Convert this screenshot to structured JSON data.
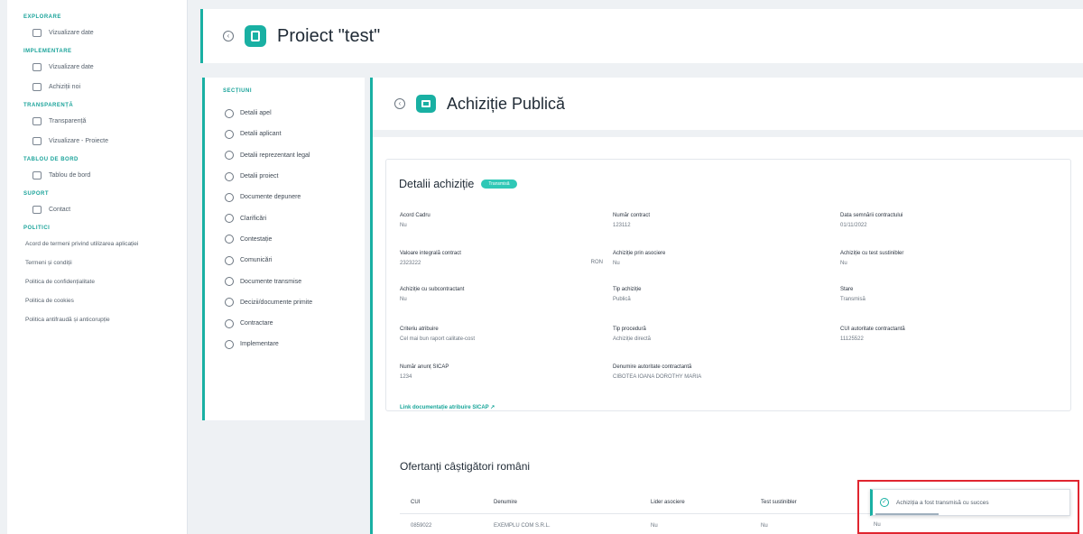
{
  "sidebar": {
    "sections": [
      {
        "title": "EXPLORARE",
        "items": [
          {
            "label": "Vizualizare date"
          }
        ]
      },
      {
        "title": "IMPLEMENTARE",
        "items": [
          {
            "label": "Vizualizare date"
          },
          {
            "label": "Achiziții noi"
          }
        ]
      },
      {
        "title": "TRANSPARENȚĂ",
        "items": [
          {
            "label": "Transparență"
          },
          {
            "label": "Vizualizare - Proiecte"
          }
        ]
      },
      {
        "title": "TABLOU DE BORD",
        "items": [
          {
            "label": "Tablou de bord"
          }
        ]
      },
      {
        "title": "SUPORT",
        "items": [
          {
            "label": "Contact"
          }
        ]
      }
    ],
    "politici_title": "POLITICI",
    "links": [
      "Acord de termeni privind utilizarea aplicației",
      "Termeni și condiții",
      "Politica de confidențialitate",
      "Politica de cookies",
      "Politica antifraudă și anticorupție"
    ]
  },
  "project": {
    "title": "Proiect \"test\""
  },
  "sections": {
    "title": "SECȚIUNI",
    "items": [
      "Detalii apel",
      "Detalii aplicant",
      "Detalii reprezentant legal",
      "Detalii proiect",
      "Documente depunere",
      "Clarificări",
      "Contestație",
      "Comunicări",
      "Documente transmise",
      "Decizii/documente primite",
      "Contractare",
      "Implementare"
    ]
  },
  "main": {
    "title": "Achiziție Publică",
    "card_title": "Detalii achiziție",
    "status_pill": "Transmisă",
    "fields": [
      {
        "label": "Acord Cadru",
        "value": "Nu"
      },
      {
        "label": "Număr contract",
        "value": "123112"
      },
      {
        "label": "Data semnării contractului",
        "value": "01/11/2022"
      },
      {
        "label": "Valoare integrală contract",
        "value": "2323222",
        "currency": "RON"
      },
      {
        "label": "Achiziție prin asociere",
        "value": "Nu"
      },
      {
        "label": "Achiziție cu test sustinibler",
        "value": "Nu"
      },
      {
        "label": "Achiziție cu subcontractant",
        "value": "Nu"
      },
      {
        "label": "Tip achiziție",
        "value": "Publică"
      },
      {
        "label": "Stare",
        "value": "Transmisă"
      },
      {
        "label": "Criteriu atribuire",
        "value": "Cel mai bun raport calitate-cost"
      },
      {
        "label": "Tip procedură",
        "value": "Achiziție directă"
      },
      {
        "label": "CUI autoritate contractantă",
        "value": "11125522"
      },
      {
        "label": "Număr anunț SICAP",
        "value": "1234"
      },
      {
        "label": "Denumire autoritate contractantă",
        "value": "CIBOTEA IOANA DOROTHY MARIA"
      }
    ],
    "sicap_link": "Link documentație atribuire SICAP",
    "winners_title": "Ofertanți câștigători români",
    "table": {
      "headers": [
        "CUI",
        "Denumire",
        "Lider asociere",
        "Test sustinibler",
        ""
      ],
      "rows": [
        [
          "0859022",
          "EXEMPLU COM S.R.L.",
          "Nu",
          "Nu",
          "Nu"
        ]
      ]
    }
  },
  "toast": {
    "message": "Achiziția a fost transmisă cu succes"
  },
  "colors": {
    "accent": "#19b0a3",
    "highlight": "#e0252f"
  },
  "icons": [
    "collapse-icon",
    "clipboard-icon",
    "id-card-icon",
    "check-circle-icon"
  ]
}
